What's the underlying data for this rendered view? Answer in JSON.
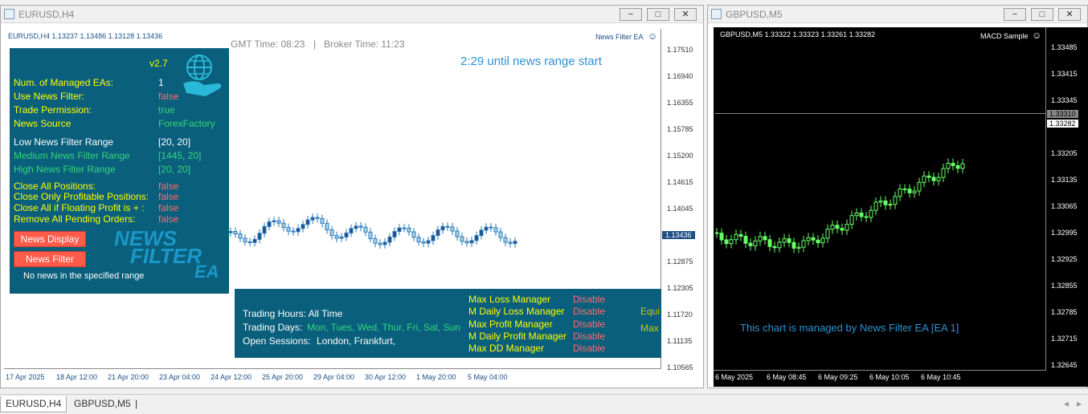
{
  "left_window": {
    "title": "EURUSD,H4",
    "symbol_line": "EURUSD,H4  1.13237 1.13486 1.13128 1.13436",
    "ea_name": "News Filter EA",
    "gmt_time": "GMT Time: 08:23",
    "separator": "|",
    "broker_time": "Broker Time: 11:23",
    "countdown": "2:29 until news range start",
    "panel": {
      "version": "v2.7",
      "rows": [
        {
          "label": "Num. of Managed EAs:",
          "value": "1"
        },
        {
          "label": "Use News Filter:",
          "value": "false"
        },
        {
          "label": "Trade Permission:",
          "value": "true"
        },
        {
          "label": "News Source",
          "value": "ForexFactory"
        },
        {
          "label": "Low News Filter Range",
          "value": "[20, 20]"
        },
        {
          "label": "Medium News Filter Range",
          "value": "[1445, 20]"
        },
        {
          "label": "High News Filter Range",
          "value": "[20, 20]"
        },
        {
          "label": "Close All Positions:",
          "value": "false"
        },
        {
          "label": "Close Only Profitable Positions:",
          "value": "false"
        },
        {
          "label": "Close All if Floating Profit is + :",
          "value": "false"
        },
        {
          "label": "Remove All Pending Orders:",
          "value": "false"
        }
      ],
      "news_display_button": "News Display",
      "news_filter_button": "News Filter",
      "no_news": "No news in the specified range",
      "logo_line1": "NEWS",
      "logo_line2": "FILTER",
      "logo_line3": "EA"
    },
    "bottom_panel": {
      "trading_hours": "Trading Hours: All Time",
      "trading_days_label": "Trading Days:",
      "trading_days_value": "Mon, Tues, Wed, Thur, Fri, Sat, Sun",
      "open_sessions_label": "Open Sessions:",
      "open_sessions_value": "London, Frankfurt,",
      "managers": [
        {
          "label": "Max Loss Manager",
          "value": "Disable"
        },
        {
          "label": "M Daily Loss Manager",
          "value": "Disable"
        },
        {
          "label": "Max Profit Manager",
          "value": "Disable"
        },
        {
          "label": "M Daily Profit Manager",
          "value": "Disable"
        },
        {
          "label": "Max DD Manager",
          "value": "Disable"
        }
      ],
      "cut_right_1": "Equi",
      "cut_right_2": "Max"
    },
    "price_ticks": [
      "1.17510",
      "1.16940",
      "1.16355",
      "1.15785",
      "1.15200",
      "1.14615",
      "1.14045",
      "1.13436",
      "1.12875",
      "1.12305",
      "1.11720",
      "1.11135",
      "1.10565"
    ],
    "current_price": "1.13436",
    "date_ticks": [
      "17 Apr 2025",
      "18 Apr 12:00",
      "21 Apr 20:00",
      "23 Apr 04:00",
      "24 Apr 12:00",
      "25 Apr 20:00",
      "29 Apr 04:00",
      "30 Apr 12:00",
      "1 May 20:00",
      "5 May 04:00"
    ]
  },
  "right_window": {
    "title": "GBPUSD,M5",
    "symbol_line": "GBPUSD,M5  1.33322 1.33323 1.33261 1.33282",
    "ea_name": "MACD Sample",
    "managed_text": "This chart is managed by News Filter EA [EA 1]",
    "price_ticks": [
      "1.33485",
      "1.33415",
      "1.33345",
      "1.33310",
      "1.33282",
      "1.33205",
      "1.33135",
      "1.33065",
      "1.32995",
      "1.32925",
      "1.32855",
      "1.32785",
      "1.32715",
      "1.32645"
    ],
    "ask_price": "1.33310",
    "bid_price": "1.33282",
    "date_ticks": [
      "6 May 2025",
      "6 May 08:45",
      "6 May 09:25",
      "6 May 10:05",
      "6 May 10:45"
    ]
  },
  "tabs": [
    "EURUSD,H4",
    "GBPUSD,M5"
  ],
  "window_buttons": {
    "minimize": "−",
    "maximize": "□",
    "close": "✕"
  }
}
